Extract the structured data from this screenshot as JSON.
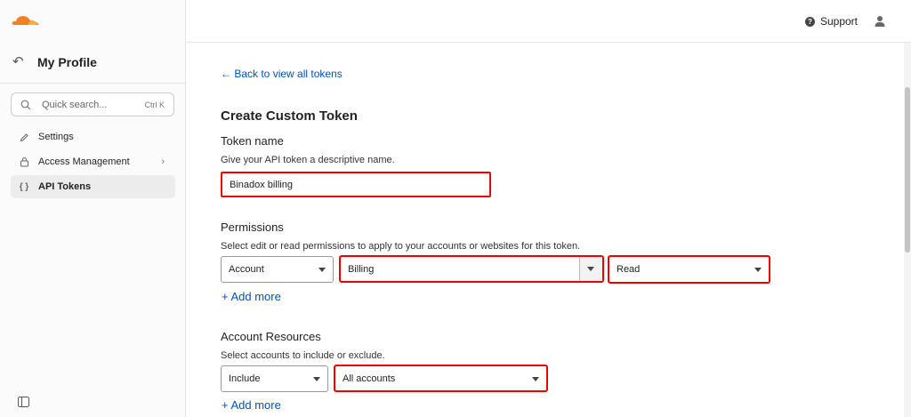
{
  "sidebar": {
    "title": "My Profile",
    "search": {
      "placeholder": "Quick search...",
      "shortcut": "Ctrl K"
    },
    "items": [
      {
        "label": "Settings",
        "icon": "pencil-icon"
      },
      {
        "label": "Access Management",
        "icon": "lock-icon"
      },
      {
        "label": "API Tokens",
        "icon": "braces-icon"
      }
    ]
  },
  "topbar": {
    "support_label": "Support"
  },
  "main": {
    "back_link": "← Back to view all tokens",
    "title": "Create Custom Token",
    "token_name": {
      "label": "Token name",
      "help": "Give your API token a descriptive name.",
      "value": "Binadox billing"
    },
    "permissions": {
      "label": "Permissions",
      "help": "Select edit or read permissions to apply to your accounts or websites for this token.",
      "scope": "Account",
      "resource": "Billing",
      "access": "Read",
      "add_more": "+ Add more"
    },
    "account_resources": {
      "label": "Account Resources",
      "help": "Select accounts to include or exclude.",
      "mode": "Include",
      "target": "All accounts",
      "add_more": "+ Add more"
    }
  },
  "colors": {
    "accent": "#0051c3",
    "highlight": "#e00000",
    "brand": "#f38020"
  }
}
